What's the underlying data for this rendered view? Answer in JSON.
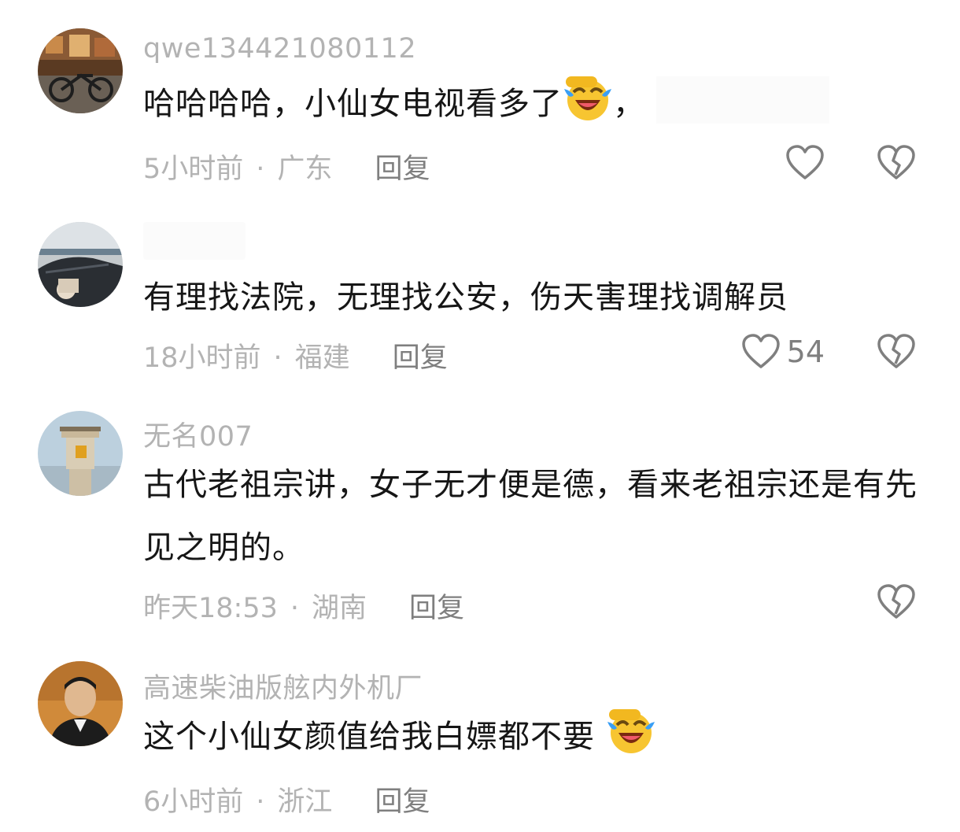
{
  "comments": [
    {
      "username": "qwe134421080112",
      "text": "哈哈哈哈，小仙女电视看多了",
      "text_suffix": "，",
      "emoji": "laughing-tears-emoji",
      "time": "5小时前",
      "location": "广东",
      "reply_label": "回复",
      "like_count": ""
    },
    {
      "username": "",
      "text": "有理找法院，无理找公安，伤天害理找调解员",
      "time": "18小时前",
      "location": "福建",
      "reply_label": "回复",
      "like_count": "54"
    },
    {
      "username": "无名007",
      "text": "古代老祖宗讲，女子无才便是德，看来老祖宗还是有先见之明的。",
      "time": "昨天18:53",
      "location": "湖南",
      "reply_label": "回复",
      "like_count": ""
    },
    {
      "username": "高速柴油版舷内外机厂",
      "text": "这个小仙女颜值给我白嫖都不要",
      "emoji": "laughing-tears-emoji",
      "time": "6小时前",
      "location": "浙江",
      "reply_label": "回复",
      "like_count": ""
    }
  ],
  "separator": "·",
  "icons": {
    "like": "heart-outline-icon",
    "dislike": "broken-heart-icon"
  },
  "colors": {
    "text": "#161616",
    "meta": "#b3b3b3",
    "reply": "#7f7f7f",
    "emoji_face": "#f7c531",
    "emoji_tears": "#3a9ff5"
  }
}
